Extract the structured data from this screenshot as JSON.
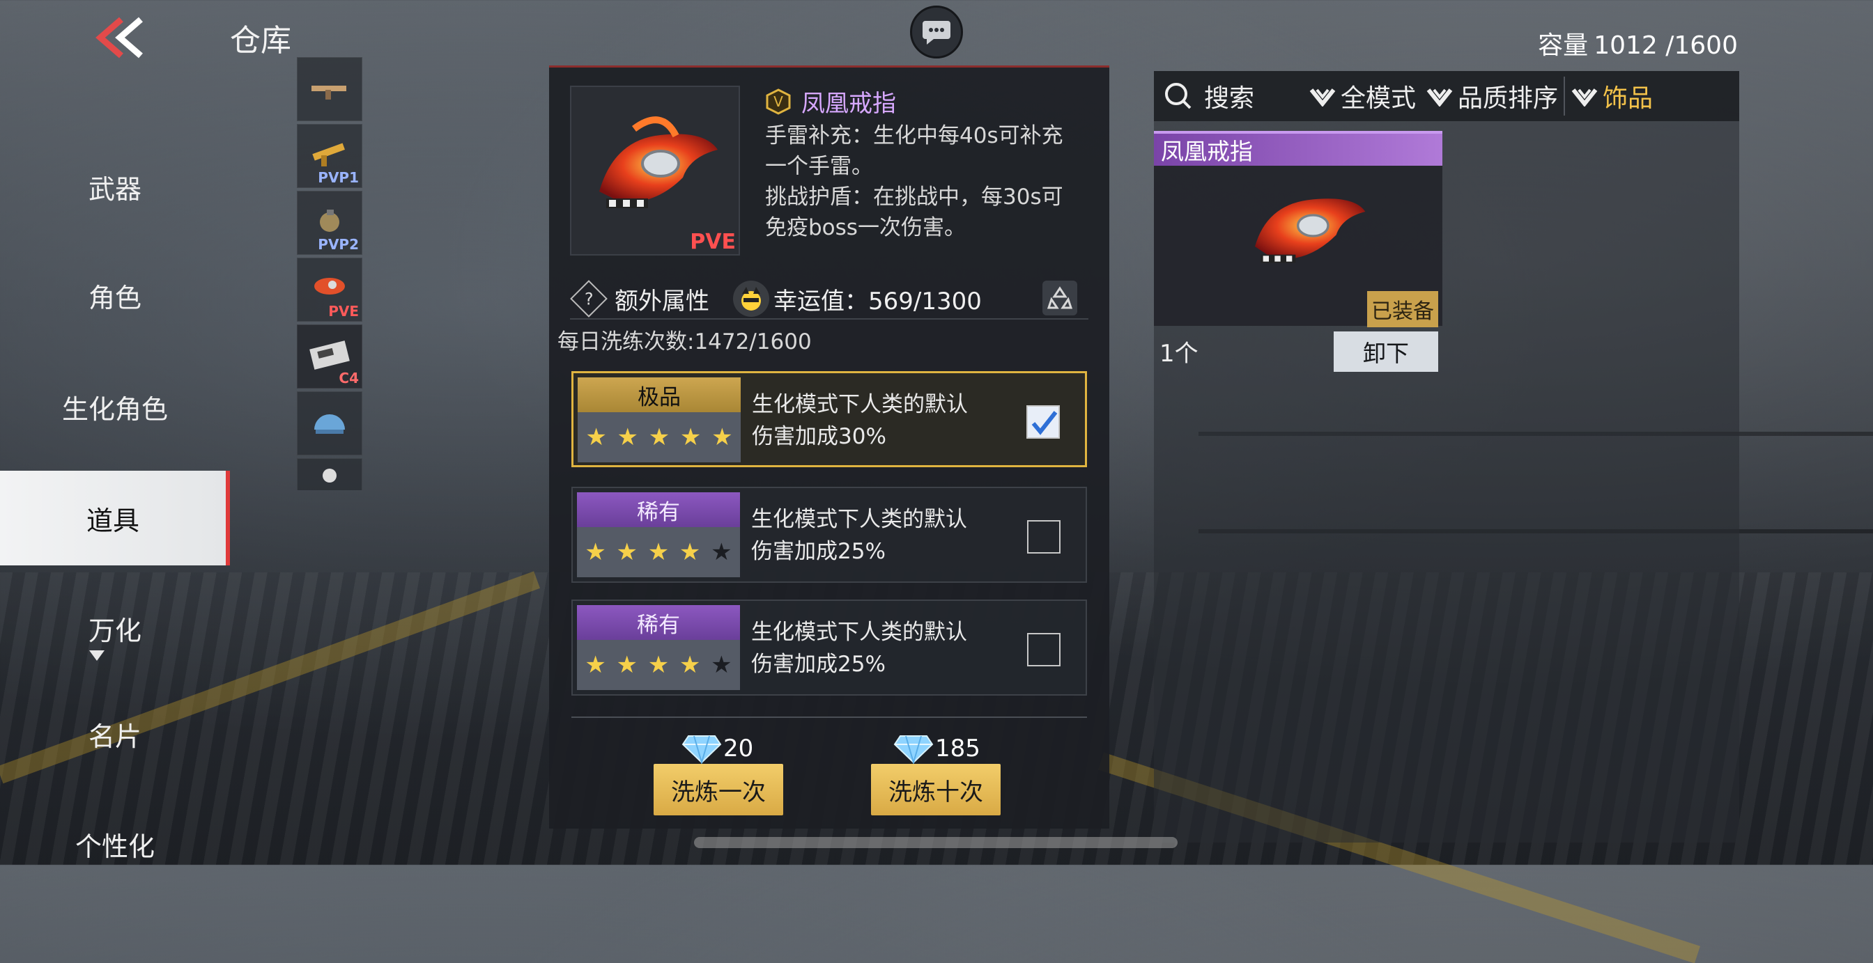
{
  "header": {
    "title": "仓库",
    "capacity_label": "容量",
    "capacity_value": "1012 /1600"
  },
  "nav": {
    "items": [
      {
        "label": "武器"
      },
      {
        "label": "角色"
      },
      {
        "label": "生化角色"
      },
      {
        "label": "道具",
        "active": true
      },
      {
        "label": "万化"
      },
      {
        "label": "名片"
      },
      {
        "label": "个性化"
      }
    ]
  },
  "thumbs": [
    {
      "tag": ""
    },
    {
      "tag": "PVP1"
    },
    {
      "tag": "PVP2"
    },
    {
      "tag": "PVE"
    },
    {
      "tag": "C4"
    },
    {
      "tag": ""
    },
    {
      "tag": ""
    }
  ],
  "detail": {
    "pve_tag": "PVE",
    "item_name": "凤凰戒指",
    "desc_lines": [
      "手雷补充：生化中每40s可补充",
      "一个手雷。",
      "挑战护盾：在挑战中，每30s可",
      "免疫boss一次伤害。"
    ],
    "extra_label": "额外属性",
    "luck_label": "幸运值：569/1300",
    "daily_count": "每日洗练次数:1472/1600",
    "attributes": [
      {
        "grade": "极品",
        "grade_color": "#c9a14c",
        "stars": 5,
        "text_line1": "生化模式下人类的默认",
        "text_line2": "伤害加成30%",
        "checked": true
      },
      {
        "grade": "稀有",
        "grade_color": "#7c4cb0",
        "stars": 4,
        "text_line1": "生化模式下人类的默认",
        "text_line2": "伤害加成25%",
        "checked": false
      },
      {
        "grade": "稀有",
        "grade_color": "#7c4cb0",
        "stars": 4,
        "text_line1": "生化模式下人类的默认",
        "text_line2": "伤害加成25%",
        "checked": false
      }
    ],
    "refine_once": {
      "cost": "20",
      "label": "洗炼一次"
    },
    "refine_ten": {
      "cost": "185",
      "label": "洗炼十次"
    }
  },
  "inventory": {
    "filters": {
      "search": "搜索",
      "mode": "全模式",
      "sort": "品质排序",
      "category": "饰品"
    },
    "card": {
      "name": "凤凰戒指",
      "equipped": "已装备",
      "count": "1个",
      "unequip": "卸下"
    }
  },
  "colors": {
    "gold": "#e0b440",
    "purple": "#8c58c0",
    "accent_yellow": "#f3c24a",
    "active_nav_border": "#e03a3a"
  }
}
